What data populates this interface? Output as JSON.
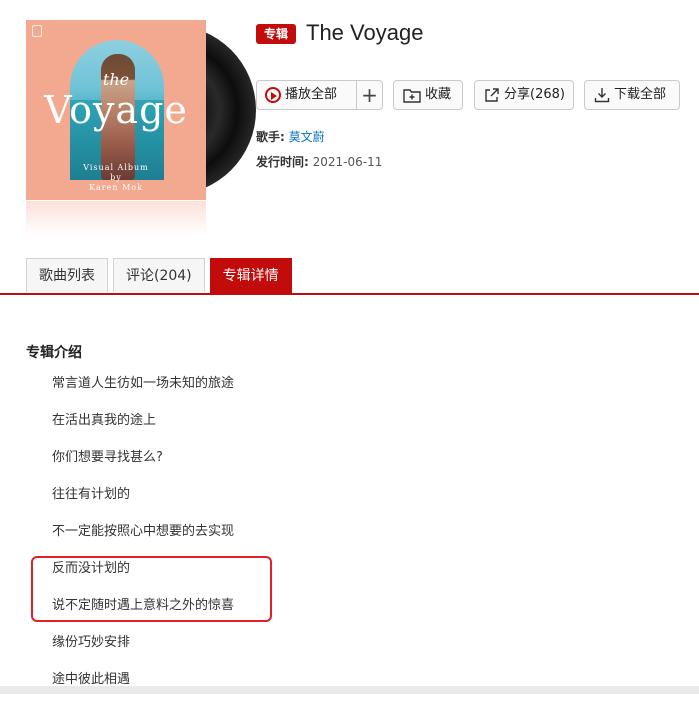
{
  "album": {
    "tag": "专辑",
    "title": "The Voyage",
    "cover": {
      "text_the": "the",
      "text_voyage": "Voyage",
      "text_subtitle": "Visual Album",
      "text_by": "by",
      "text_artist": "Karen Mok"
    }
  },
  "actions": {
    "play_all": "播放全部",
    "add": "+",
    "favorite": "收藏",
    "share": "分享(268)",
    "download_all": "下载全部"
  },
  "meta": {
    "artist_label": "歌手:",
    "artist_name": "莫文蔚",
    "release_label": "发行时间:",
    "release_date": "2021-06-11"
  },
  "tabs": [
    {
      "label": "歌曲列表",
      "active": false
    },
    {
      "label": "评论(204)",
      "active": false
    },
    {
      "label": "专辑详情",
      "active": true
    }
  ],
  "intro": {
    "heading": "专辑介绍",
    "lines": [
      "常言道人生彷如一场未知的旅途",
      "在活出真我的途上",
      "你们想要寻找甚么?",
      "往往有计划的",
      "不一定能按照心中想要的去实现",
      "反而没计划的",
      "说不定随时遇上意料之外的惊喜",
      "缘份巧妙安排",
      "途中彼此相遇"
    ]
  },
  "colors": {
    "accent": "#c20c0c",
    "link": "#0c73c2",
    "highlight_box": "#e0202a",
    "cover_bg": "#f3a98f"
  }
}
